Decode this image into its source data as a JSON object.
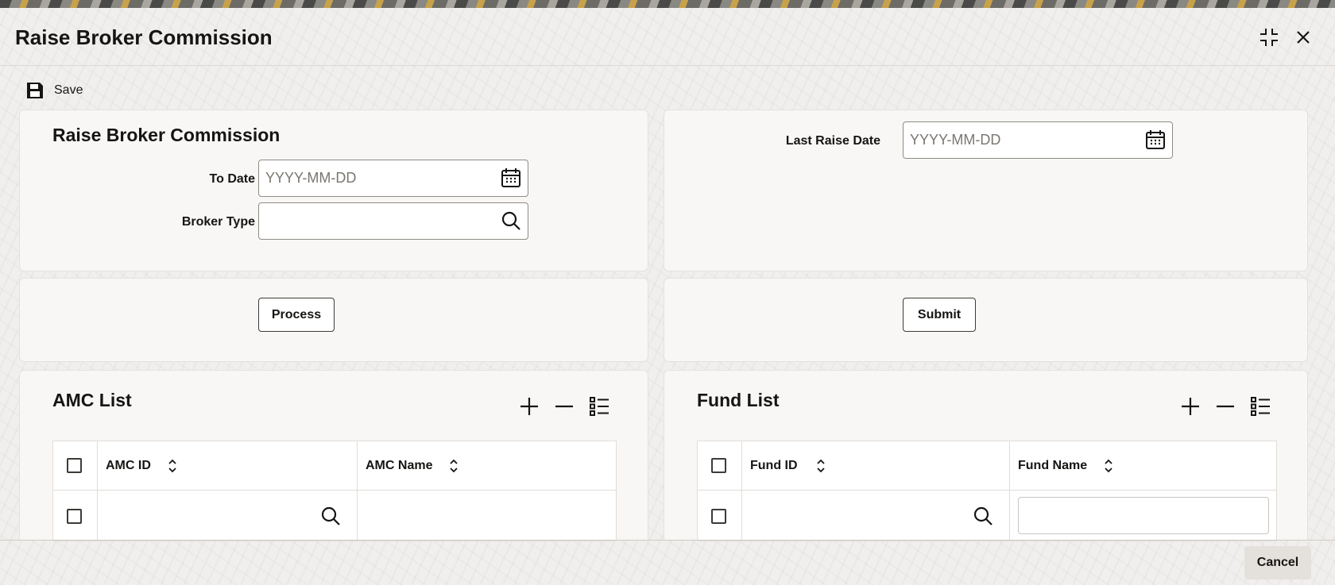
{
  "window": {
    "title": "Raise Broker Commission",
    "maximize_icon": "maximize-icon",
    "close_icon": "close-icon"
  },
  "toolbar": {
    "save_label": "Save",
    "save_icon": "floppy-disk-icon"
  },
  "main_form": {
    "section_title": "Raise Broker Commission",
    "to_date_label": "To Date",
    "to_date_placeholder": "YYYY-MM-DD",
    "broker_type_label": "Broker Type",
    "broker_type_value": "",
    "last_raise_date_label": "Last Raise Date",
    "last_raise_date_placeholder": "YYYY-MM-DD"
  },
  "actions": {
    "process_label": "Process",
    "submit_label": "Submit"
  },
  "amc_list": {
    "title": "AMC List",
    "columns": [
      "AMC ID",
      "AMC Name"
    ],
    "rows": [
      {
        "amc_id": "",
        "amc_name": ""
      }
    ]
  },
  "fund_list": {
    "title": "Fund List",
    "columns": [
      "Fund ID",
      "Fund Name"
    ],
    "rows": [
      {
        "fund_id": "",
        "fund_name": ""
      }
    ]
  },
  "footer": {
    "cancel_label": "Cancel"
  },
  "colors": {
    "text": "#161513",
    "border": "#8f8b86",
    "panel_bg": "#f8f7f5",
    "cancel_bg": "#e4e1dd"
  }
}
